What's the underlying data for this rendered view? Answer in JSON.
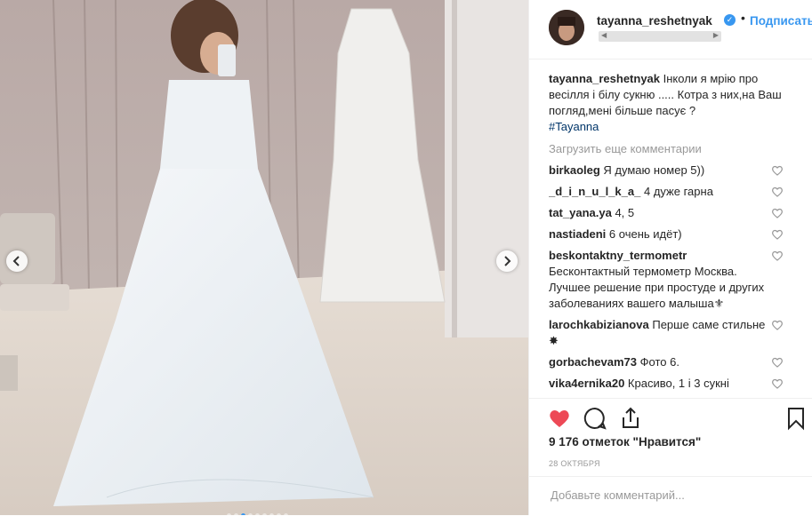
{
  "post": {
    "author": "tayanna_reshetnyak",
    "follow_label": "Подписаться",
    "caption_text": "Інколи я мрію про весілля і білу сукню ..... Котра з них,на Ваш погляд,мені більше пасує ?",
    "caption_tag": "#Tayanna",
    "load_more": "Загрузить еще комментарии",
    "likes": "9 176 отметок \"Нравится\"",
    "date": "28 ОКТЯБРЯ",
    "add_comment_placeholder": "Добавьте комментарий..."
  },
  "comments": [
    {
      "user": "birkaoleg",
      "text": "Я думаю номер 5))"
    },
    {
      "user": "_d_i_n_u_l_k_a_",
      "text": "4 дуже гарна"
    },
    {
      "user": "tat_yana.ya",
      "text": "4, 5"
    },
    {
      "user": "nastiadeni",
      "text": "6 очень идёт)"
    },
    {
      "user": "beskontaktny_termometr",
      "text": "Бесконтактный термометр Москва. Лучшее решение при простуде и других заболеваниях вашего малыша⚜"
    },
    {
      "user": "larochkabizianova",
      "text": "Перше саме стильне ✸"
    },
    {
      "user": "gorbachevam73",
      "text": "Фото 6."
    },
    {
      "user": "vika4ernika20",
      "text": "Красиво, 1 і 3 сукні"
    }
  ],
  "carousel": {
    "count": 9,
    "active_index": 2
  },
  "icons": {
    "verified": "verified-badge-icon",
    "like": "heart-filled-icon",
    "comment": "comment-icon",
    "share": "share-icon",
    "save": "bookmark-icon",
    "prev": "chevron-left-icon",
    "next": "chevron-right-icon"
  },
  "colors": {
    "accent": "#3897f0",
    "like": "#ed4956",
    "text": "#262626",
    "muted": "#999999"
  }
}
